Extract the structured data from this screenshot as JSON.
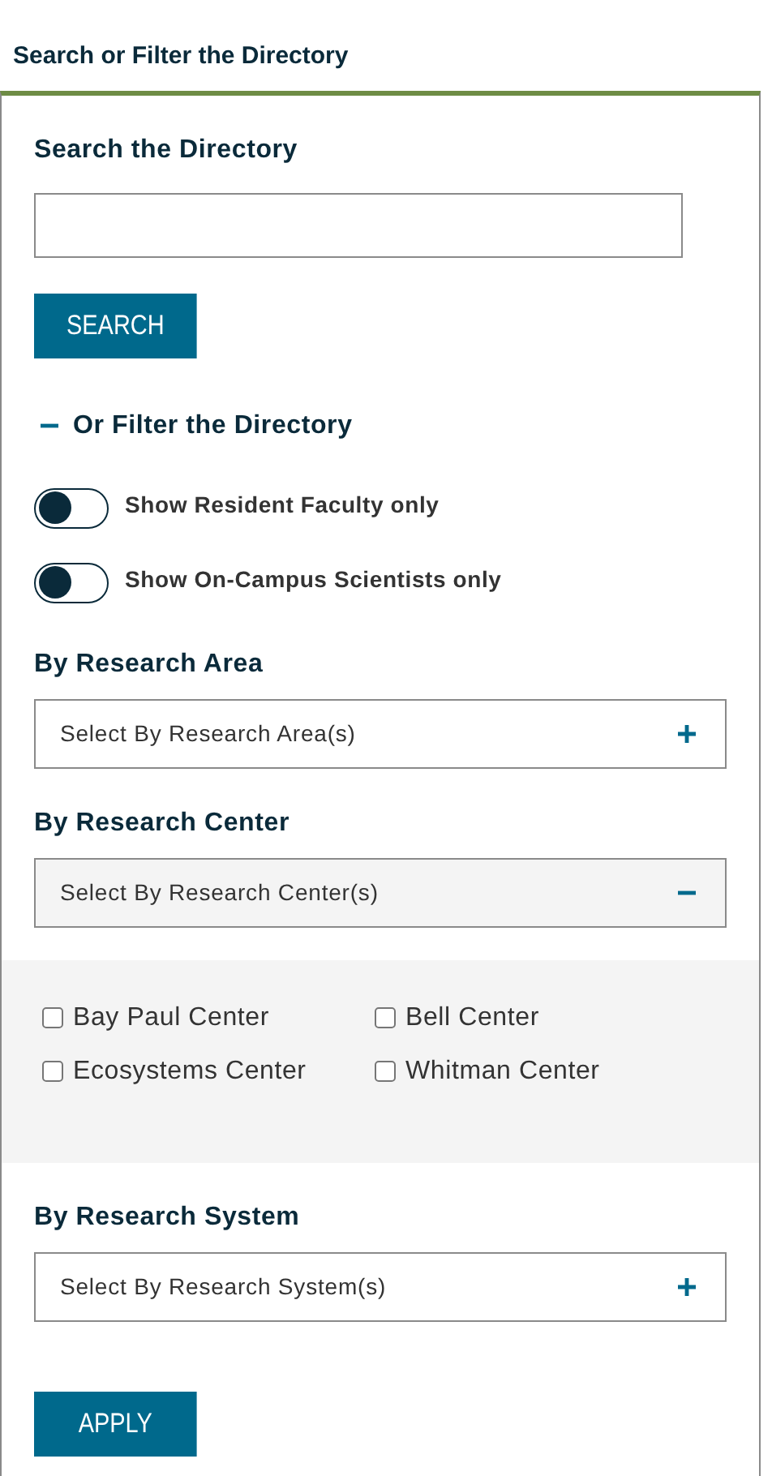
{
  "header": {
    "title": "Search or Filter the Directory"
  },
  "search": {
    "label": "Search the Directory",
    "button": "SEARCH"
  },
  "filter": {
    "title": "Or Filter the Directory",
    "expanded": true,
    "toggles": [
      {
        "label": "Show Resident Faculty only",
        "on": false
      },
      {
        "label": "Show On-Campus Scientists only",
        "on": false
      }
    ],
    "groups": [
      {
        "label": "By Research Area",
        "placeholder": "Select By Research Area(s)",
        "expanded": false
      },
      {
        "label": "By Research Center",
        "placeholder": "Select By Research Center(s)",
        "expanded": true,
        "options": [
          {
            "label": "Bay Paul Center",
            "checked": false
          },
          {
            "label": "Bell Center",
            "checked": false
          },
          {
            "label": "Ecosystems Center",
            "checked": false
          },
          {
            "label": "Whitman Center",
            "checked": false
          }
        ]
      },
      {
        "label": "By Research System",
        "placeholder": "Select By Research System(s)",
        "expanded": false
      }
    ],
    "apply_button": "APPLY"
  }
}
